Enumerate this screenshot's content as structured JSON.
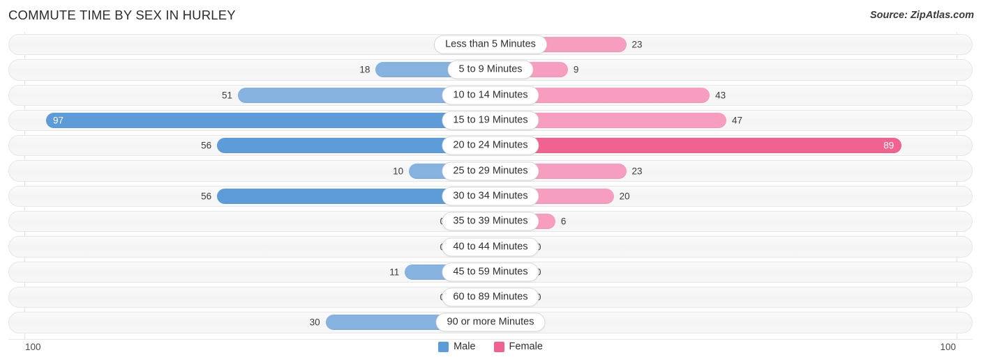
{
  "header": {
    "title": "COMMUTE TIME BY SEX IN HURLEY",
    "source": "Source: ZipAtlas.com"
  },
  "axis": {
    "left_max": "100",
    "right_max": "100",
    "max_value": 100
  },
  "legend": {
    "items": [
      {
        "label": "Male",
        "color": "#5d9cd8"
      },
      {
        "label": "Female",
        "color": "#f0628f"
      }
    ]
  },
  "colors": {
    "male_light": "#86b2e0",
    "male_strong": "#5d9cd8",
    "female_light": "#f79ec0",
    "female_strong": "#f0628f",
    "track": "#f6f6f6",
    "text": "#2d2d2d"
  },
  "chart_data": {
    "type": "bar",
    "title": "COMMUTE TIME BY SEX IN HURLEY",
    "subtitle": "Source: ZipAtlas.com",
    "orientation": "horizontal-diverging",
    "xlabel": "",
    "ylabel": "",
    "xlim": [
      100,
      100
    ],
    "grid": false,
    "legend_position": "bottom-center",
    "categories": [
      "Less than 5 Minutes",
      "5 to 9 Minutes",
      "10 to 14 Minutes",
      "15 to 19 Minutes",
      "20 to 24 Minutes",
      "25 to 29 Minutes",
      "30 to 34 Minutes",
      "35 to 39 Minutes",
      "40 to 44 Minutes",
      "45 to 59 Minutes",
      "60 to 89 Minutes",
      "90 or more Minutes"
    ],
    "series": [
      {
        "name": "Male",
        "values": [
          0,
          18,
          51,
          97,
          56,
          10,
          56,
          0,
          0,
          11,
          0,
          30
        ]
      },
      {
        "name": "Female",
        "values": [
          23,
          9,
          43,
          47,
          89,
          23,
          20,
          6,
          0,
          0,
          0,
          0
        ]
      }
    ]
  },
  "rows": [
    {
      "label": "Less than 5 Minutes",
      "male": "0",
      "male_v": 0,
      "female": "23",
      "female_v": 23
    },
    {
      "label": "5 to 9 Minutes",
      "male": "18",
      "male_v": 18,
      "female": "9",
      "female_v": 9
    },
    {
      "label": "10 to 14 Minutes",
      "male": "51",
      "male_v": 51,
      "female": "43",
      "female_v": 43
    },
    {
      "label": "15 to 19 Minutes",
      "male": "97",
      "male_v": 97,
      "female": "47",
      "female_v": 47
    },
    {
      "label": "20 to 24 Minutes",
      "male": "56",
      "male_v": 56,
      "female": "89",
      "female_v": 89
    },
    {
      "label": "25 to 29 Minutes",
      "male": "10",
      "male_v": 10,
      "female": "23",
      "female_v": 23
    },
    {
      "label": "30 to 34 Minutes",
      "male": "56",
      "male_v": 56,
      "female": "20",
      "female_v": 20
    },
    {
      "label": "35 to 39 Minutes",
      "male": "0",
      "male_v": 0,
      "female": "6",
      "female_v": 6
    },
    {
      "label": "40 to 44 Minutes",
      "male": "0",
      "male_v": 0,
      "female": "0",
      "female_v": 0
    },
    {
      "label": "45 to 59 Minutes",
      "male": "11",
      "male_v": 11,
      "female": "0",
      "female_v": 0
    },
    {
      "label": "60 to 89 Minutes",
      "male": "0",
      "male_v": 0,
      "female": "0",
      "female_v": 0
    },
    {
      "label": "90 or more Minutes",
      "male": "30",
      "male_v": 30,
      "female": "0",
      "female_v": 0
    }
  ]
}
